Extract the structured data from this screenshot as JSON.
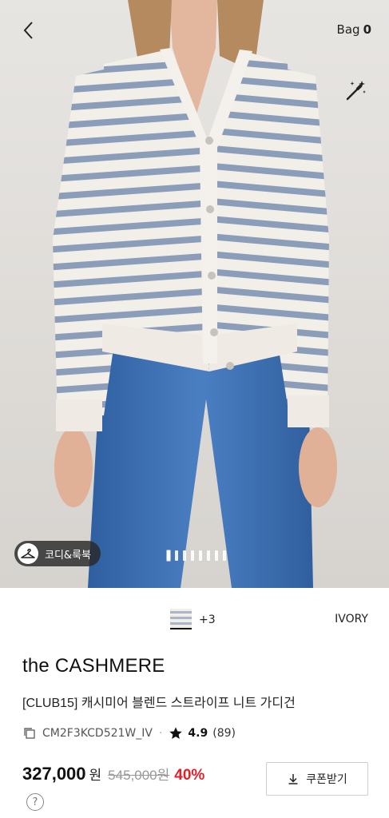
{
  "header": {
    "bag_label": "Bag",
    "bag_count": "0"
  },
  "gallery": {
    "coordi_label": "코디&룩북",
    "image_count": 8,
    "active_index": 0
  },
  "options": {
    "more_colors": "+3",
    "color_name": "IVORY"
  },
  "product": {
    "brand": "the CASHMERE",
    "name": "[CLUB15] 캐시미어 블렌드 스트라이프 니트 가디건",
    "code": "CM2F3KCD521W_IV",
    "separator": "·",
    "rating": "4.9",
    "reviews": "(89)"
  },
  "price": {
    "sale": "327,000",
    "currency": "원",
    "original": "545,000원",
    "discount": "40%",
    "help": "?"
  },
  "actions": {
    "coupon_label": "쿠폰받기"
  },
  "colors": {
    "discount_red": "#e0202b",
    "stripe_blue": "#8b9db8",
    "denim": "#3c6fb3"
  },
  "icons": [
    "chevron-left-icon",
    "magic-wand-icon",
    "hanger-icon",
    "copy-icon",
    "star-icon",
    "download-icon",
    "help-icon"
  ]
}
